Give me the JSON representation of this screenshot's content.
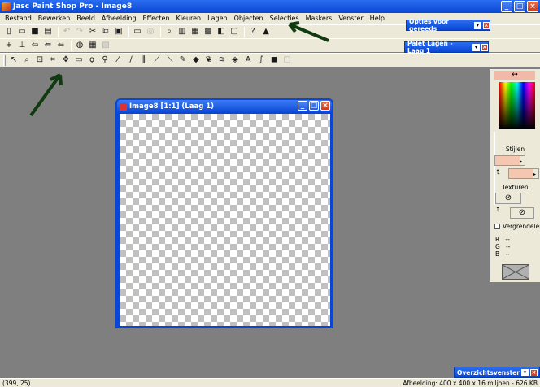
{
  "app": {
    "title": "Jasc Paint Shop Pro - Image8"
  },
  "menu": [
    "Bestand",
    "Bewerken",
    "Beeld",
    "Afbeelding",
    "Effecten",
    "Kleuren",
    "Lagen",
    "Objecten",
    "Selecties",
    "Maskers",
    "Venster",
    "Help"
  ],
  "palettes": {
    "tool_options": "Opties voor gereeds",
    "layers": "Palet Lagen - Laag 1",
    "overview": "Overzichtsvenster"
  },
  "image_window": {
    "title": "Image8 [1:1] (Laag 1)"
  },
  "color_panel": {
    "swap_icon": "↔",
    "styles_label": "Stijlen",
    "textures_label": "Texturen",
    "lock_label": "Vergrendelen",
    "rgb": [
      {
        "k": "R",
        "v": "--"
      },
      {
        "k": "G",
        "v": "--"
      },
      {
        "k": "B",
        "v": "--"
      }
    ]
  },
  "status": {
    "coords": "(399, 25)",
    "image_info": "Afbeelding: 400 x 400 x 16 miljoen - 626 KB"
  }
}
